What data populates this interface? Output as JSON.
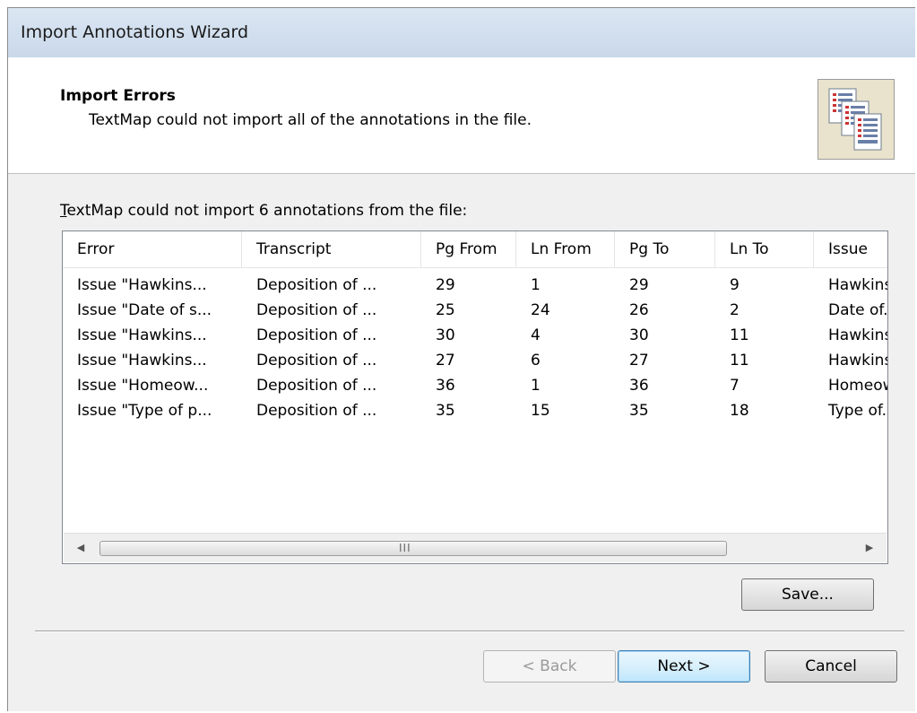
{
  "window": {
    "title": "Import Annotations Wizard"
  },
  "header": {
    "title": "Import Errors",
    "subtitle": "TextMap could not import all of the annotations in the file.",
    "icon": "documents-icon"
  },
  "list": {
    "label_prefix": "T",
    "label_rest": "extMap could not import 6 annotations from the file:",
    "columns": [
      "Error",
      "Transcript",
      "Pg From",
      "Ln From",
      "Pg To",
      "Ln To",
      "Issue"
    ],
    "rows": [
      [
        "Issue \"Hawkins...",
        "Deposition of ...",
        "29",
        "1",
        "29",
        "9",
        "Hawkins..."
      ],
      [
        "Issue \"Date of s...",
        "Deposition of ...",
        "25",
        "24",
        "26",
        "2",
        "Date of..."
      ],
      [
        "Issue \"Hawkins...",
        "Deposition of ...",
        "30",
        "4",
        "30",
        "11",
        "Hawkins..."
      ],
      [
        "Issue \"Hawkins...",
        "Deposition of ...",
        "27",
        "6",
        "27",
        "11",
        "Hawkins..."
      ],
      [
        "Issue \"Homeow...",
        "Deposition of ...",
        "36",
        "1",
        "36",
        "7",
        "Homeow..."
      ],
      [
        "Issue \"Type of p...",
        "Deposition of ...",
        "35",
        "15",
        "35",
        "18",
        "Type of..."
      ]
    ],
    "scroll_grip": "III"
  },
  "buttons": {
    "save": "Save...",
    "back": "< Back",
    "next": "Next >",
    "cancel": "Cancel"
  }
}
